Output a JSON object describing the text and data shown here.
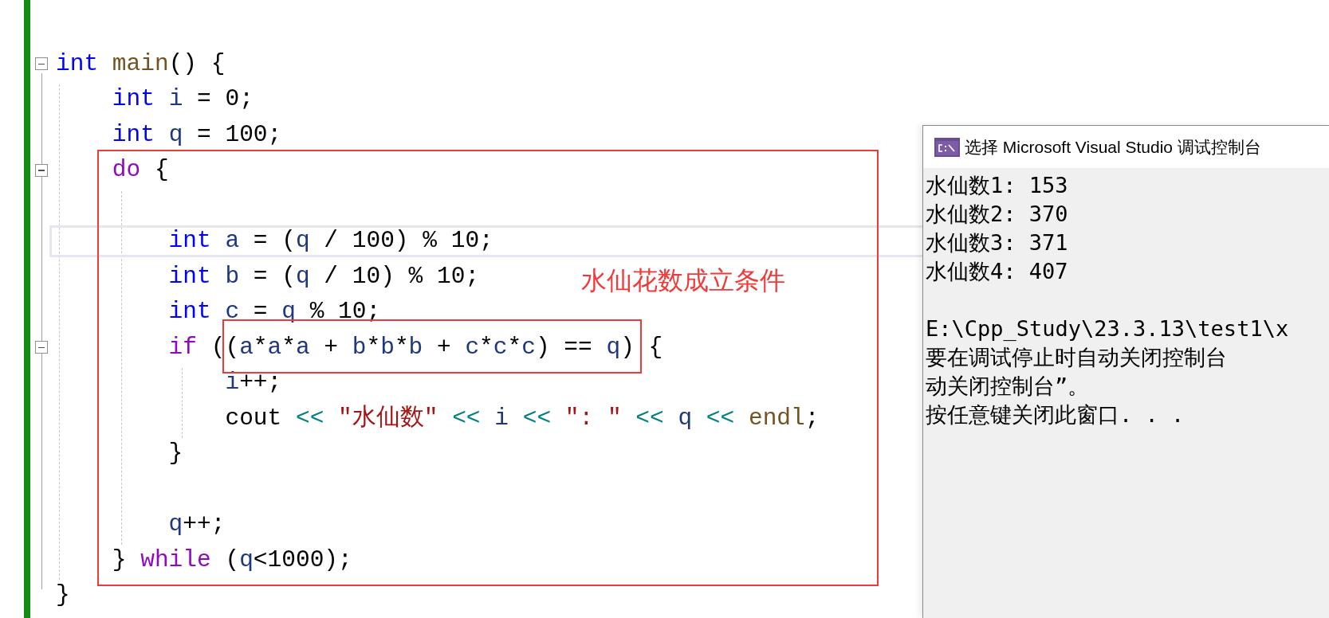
{
  "editor": {
    "lines": [
      {
        "fold": true,
        "current": false,
        "tokens": [
          {
            "text": "int ",
            "kind": "keyword"
          },
          {
            "text": "main",
            "kind": "function"
          },
          {
            "text": "() {",
            "kind": "plain"
          }
        ]
      },
      {
        "fold": false,
        "current": false,
        "tokens": [
          {
            "text": "    int ",
            "kind": "keyword"
          },
          {
            "text": "i",
            "kind": "variable"
          },
          {
            "text": " = 0;",
            "kind": "plain"
          }
        ]
      },
      {
        "fold": false,
        "current": false,
        "tokens": [
          {
            "text": "    int ",
            "kind": "keyword"
          },
          {
            "text": "q",
            "kind": "variable"
          },
          {
            "text": " = 100;",
            "kind": "plain"
          }
        ]
      },
      {
        "fold": true,
        "current": false,
        "tokens": [
          {
            "text": "    do",
            "kind": "control"
          },
          {
            "text": " {",
            "kind": "plain"
          }
        ]
      },
      {
        "fold": false,
        "current": false
      },
      {
        "fold": false,
        "current": true,
        "tokens": [
          {
            "text": "        int ",
            "kind": "keyword"
          },
          {
            "text": "a",
            "kind": "variable"
          },
          {
            "text": " = (",
            "kind": "plain"
          },
          {
            "text": "q",
            "kind": "variable"
          },
          {
            "text": " / 100) % 10;",
            "kind": "plain"
          }
        ]
      },
      {
        "fold": false,
        "current": false,
        "tokens": [
          {
            "text": "        int ",
            "kind": "keyword"
          },
          {
            "text": "b",
            "kind": "variable"
          },
          {
            "text": " = (",
            "kind": "plain"
          },
          {
            "text": "q",
            "kind": "variable"
          },
          {
            "text": " / 10) % 10;",
            "kind": "plain"
          }
        ]
      },
      {
        "fold": false,
        "current": false,
        "tokens": [
          {
            "text": "        int ",
            "kind": "keyword"
          },
          {
            "text": "c",
            "kind": "variable"
          },
          {
            "text": " = ",
            "kind": "plain"
          },
          {
            "text": "q",
            "kind": "variable"
          },
          {
            "text": " % 10;",
            "kind": "plain"
          }
        ]
      },
      {
        "fold": true,
        "current": false,
        "tokens": [
          {
            "text": "        if",
            "kind": "control"
          },
          {
            "text": " ((",
            "kind": "plain"
          },
          {
            "text": "a",
            "kind": "variable"
          },
          {
            "text": "*",
            "kind": "plain"
          },
          {
            "text": "a",
            "kind": "variable"
          },
          {
            "text": "*",
            "kind": "plain"
          },
          {
            "text": "a",
            "kind": "variable"
          },
          {
            "text": " + ",
            "kind": "plain"
          },
          {
            "text": "b",
            "kind": "variable"
          },
          {
            "text": "*",
            "kind": "plain"
          },
          {
            "text": "b",
            "kind": "variable"
          },
          {
            "text": "*",
            "kind": "plain"
          },
          {
            "text": "b",
            "kind": "variable"
          },
          {
            "text": " + ",
            "kind": "plain"
          },
          {
            "text": "c",
            "kind": "variable"
          },
          {
            "text": "*",
            "kind": "plain"
          },
          {
            "text": "c",
            "kind": "variable"
          },
          {
            "text": "*",
            "kind": "plain"
          },
          {
            "text": "c",
            "kind": "variable"
          },
          {
            "text": ") == ",
            "kind": "plain"
          },
          {
            "text": "q",
            "kind": "variable"
          },
          {
            "text": ") {",
            "kind": "plain"
          }
        ]
      },
      {
        "fold": false,
        "current": false,
        "tokens": [
          {
            "text": "            i",
            "kind": "variable"
          },
          {
            "text": "++;",
            "kind": "plain"
          }
        ]
      },
      {
        "fold": false,
        "current": false,
        "tokens": [
          {
            "text": "            cout ",
            "kind": "plain"
          },
          {
            "text": "<< ",
            "kind": "operator"
          },
          {
            "text": "\"水仙数\" ",
            "kind": "string"
          },
          {
            "text": "<< ",
            "kind": "operator"
          },
          {
            "text": "i ",
            "kind": "variable"
          },
          {
            "text": "<< ",
            "kind": "operator"
          },
          {
            "text": "\": \" ",
            "kind": "string"
          },
          {
            "text": "<< ",
            "kind": "operator"
          },
          {
            "text": "q ",
            "kind": "variable"
          },
          {
            "text": "<< ",
            "kind": "operator"
          },
          {
            "text": "endl",
            "kind": "function"
          },
          {
            "text": ";",
            "kind": "plain"
          }
        ]
      },
      {
        "fold": false,
        "current": false,
        "tokens": [
          {
            "text": "        }",
            "kind": "plain"
          }
        ]
      },
      {
        "fold": false,
        "current": false
      },
      {
        "fold": false,
        "current": false,
        "tokens": [
          {
            "text": "        q",
            "kind": "variable"
          },
          {
            "text": "++;",
            "kind": "plain"
          }
        ]
      },
      {
        "fold": false,
        "current": false,
        "tokens": [
          {
            "text": "    } ",
            "kind": "plain"
          },
          {
            "text": "while",
            "kind": "control"
          },
          {
            "text": " (",
            "kind": "plain"
          },
          {
            "text": "q",
            "kind": "variable"
          },
          {
            "text": "<1000);",
            "kind": "plain"
          }
        ]
      },
      {
        "fold": false,
        "current": false,
        "tokens": [
          {
            "text": "}",
            "kind": "plain"
          }
        ]
      }
    ]
  },
  "annotation": {
    "label": "水仙花数成立条件"
  },
  "console": {
    "title": "选择 Microsoft Visual Studio 调试控制台",
    "output": [
      "水仙数1: 153",
      "水仙数2: 370",
      "水仙数3: 371",
      "水仙数4: 407"
    ],
    "messages": [
      "E:\\Cpp_Study\\23.3.13\\test1\\x",
      "要在调试停止时自动关闭控制台",
      "动关闭控制台”。",
      "按任意键关闭此窗口. . ."
    ]
  }
}
